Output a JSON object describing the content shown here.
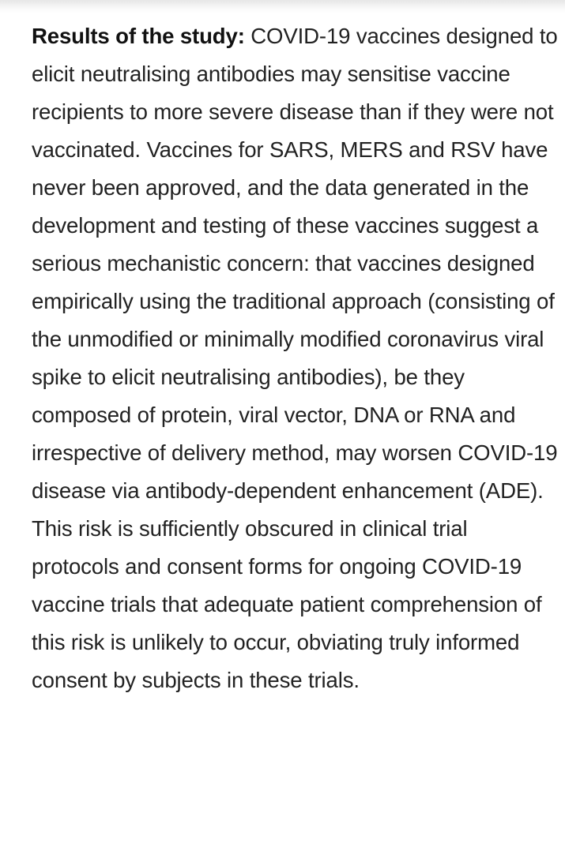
{
  "article": {
    "lead": "Results of the study:",
    "body": "COVID-19 vaccines designed to elicit neutralising antibodies may sensitise vaccine recipients to more severe disease than if they were not vaccinated. Vaccines for SARS, MERS and RSV have never been approved, and the data generated in the development and testing of these vaccines suggest a serious mechanistic concern: that vaccines designed empirically using the traditional approach (consisting of the unmodified or minimally modified coronavirus viral spike to elicit neutralising antibodies), be they composed of protein, viral vector, DNA or RNA and irrespective of delivery method, may worsen COVID-19 disease via antibody-dependent enhancement (ADE). This risk is sufficiently obscured in clinical trial protocols and consent forms for ongoing COVID-19 vaccine trials that adequate patient comprehension of this risk is unlikely to occur, obviating truly informed consent by subjects in these trials."
  }
}
